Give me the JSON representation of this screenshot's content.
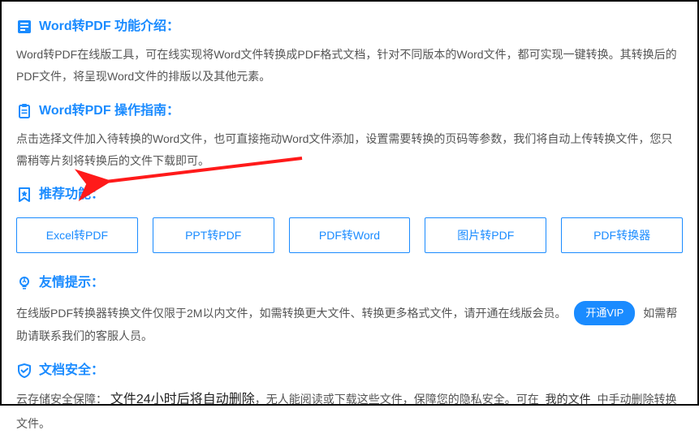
{
  "sections": {
    "intro": {
      "title": "Word转PDF 功能介绍："
    },
    "guide": {
      "title": "Word转PDF 操作指南："
    },
    "recommend": {
      "title": "推荐功能："
    },
    "tips": {
      "title": "友情提示："
    },
    "security": {
      "title": "文档安全："
    }
  },
  "intro_text": "Word转PDF在线版工具，可在线实现将Word文件转换成PDF格式文档，针对不同版本的Word文件，都可实现一键转换。其转换后的PDF文件，将呈现Word文件的排版以及其他元素。",
  "guide_text": "点击选择文件加入待转换的Word文件，也可直接拖动Word文件添加，设置需要转换的页码等参数，我们将自动上传转换文件，您只需稍等片刻将转换后的文件下载即可。",
  "recommend_buttons": [
    "Excel转PDF",
    "PPT转PDF",
    "PDF转Word",
    "图片转PDF",
    "PDF转换器"
  ],
  "tips_before": "在线版PDF转换器转换文件仅限于2M以内文件，如需转换更大文件、转换更多格式文件，请开通在线版会员。",
  "tips_vip": "开通VIP",
  "tips_after": "如需帮助请联系我们的客服人员。",
  "security_pre": "云存储安全保障：",
  "security_bold": "文件24小时后将自动删除",
  "security_mid": "，无人能阅读或下载这些文件，保障您的隐私安全。可在",
  "security_link": "我的文件",
  "security_post": "中手动删除转换文件。"
}
